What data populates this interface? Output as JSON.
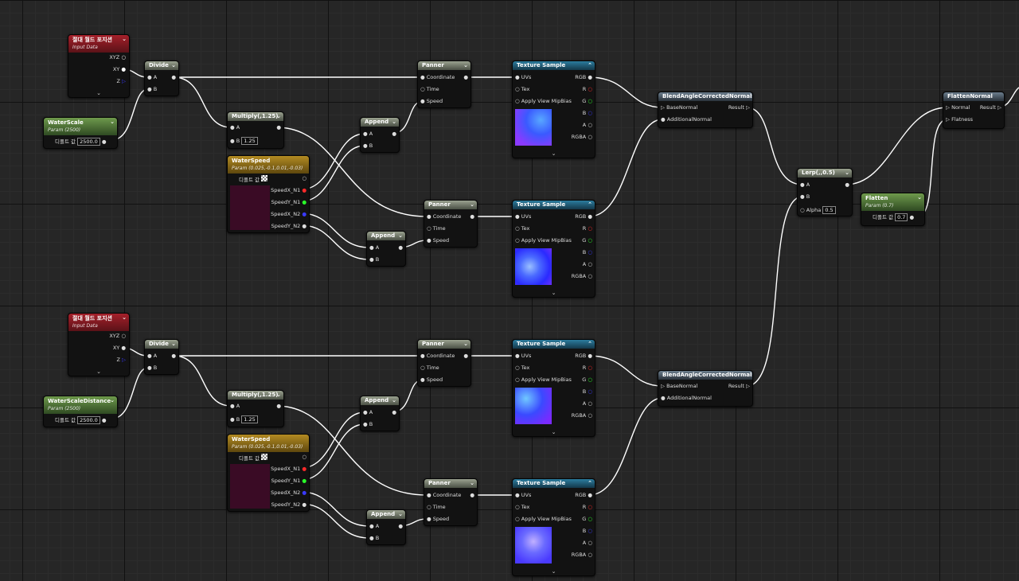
{
  "nodes": {
    "absworld1": {
      "title": "절대 월드 포지션",
      "sub": "Input Data",
      "pins": [
        "XYZ",
        "XY",
        "Z"
      ]
    },
    "absworld2": {
      "title": "절대 월드 포지션",
      "sub": "Input Data",
      "pins": [
        "XYZ",
        "XY",
        "Z"
      ]
    },
    "waterscale": {
      "title": "WaterScale",
      "sub": "Param (2500)",
      "label": "디폴트 값",
      "value": "2500.0"
    },
    "waterscaledist": {
      "title": "WaterScaleDistance",
      "sub": "Param (2500)",
      "label": "디폴트 값",
      "value": "2500.0"
    },
    "divide1": {
      "title": "Divide",
      "pins": [
        "A",
        "B"
      ]
    },
    "divide2": {
      "title": "Divide",
      "pins": [
        "A",
        "B"
      ]
    },
    "multiply1": {
      "title": "Multiply(,1.25)",
      "pins": [
        "A",
        "B"
      ],
      "value": "1.25"
    },
    "multiply2": {
      "title": "Multiply(,1.25)",
      "pins": [
        "A",
        "B"
      ],
      "value": "1.25"
    },
    "waterspeed1": {
      "title": "WaterSpeed",
      "sub": "Param (0.025,-0.1,0.01,-0.03)",
      "label": "디폴트 값",
      "pins": [
        "SpeedX_N1",
        "SpeedY_N1",
        "SpeedX_N2",
        "SpeedY_N2"
      ]
    },
    "waterspeed2": {
      "title": "WaterSpeed",
      "sub": "Param (0.025,-0.1,0.01,-0.03)",
      "label": "디폴트 값",
      "pins": [
        "SpeedX_N1",
        "SpeedY_N1",
        "SpeedX_N2",
        "SpeedY_N2"
      ]
    },
    "append": {
      "title": "Append",
      "pins": [
        "A",
        "B"
      ]
    },
    "panner": {
      "title": "Panner",
      "pins": [
        "Coordinate",
        "Time",
        "Speed"
      ]
    },
    "texsample": {
      "title": "Texture Sample",
      "inputs": [
        "UVs",
        "Tex",
        "Apply View MipBias"
      ],
      "outputs": [
        "RGB",
        "R",
        "G",
        "B",
        "A",
        "RGBA"
      ]
    },
    "blend": {
      "title": "BlendAngleCorrectedNormals",
      "inputs": [
        "BaseNormal",
        "AdditionalNormal"
      ],
      "output": "Result"
    },
    "lerp": {
      "title": "Lerp(,,0.5)",
      "pins": [
        "A",
        "B",
        "Alpha"
      ],
      "alpha": "0.5"
    },
    "flatten": {
      "title": "Flatten",
      "sub": "Param (0.7)",
      "label": "디폴트 값",
      "value": "0.7"
    },
    "flattennormal": {
      "title": "FlattenNormal",
      "inputs": [
        "Normal",
        "Flatness"
      ],
      "output": "Result"
    }
  },
  "colors": {
    "bg": "#262626",
    "wire": "#ffffff",
    "pinR": "#ff2a2a",
    "pinG": "#2aff2a",
    "pinB": "#3a3aff"
  }
}
